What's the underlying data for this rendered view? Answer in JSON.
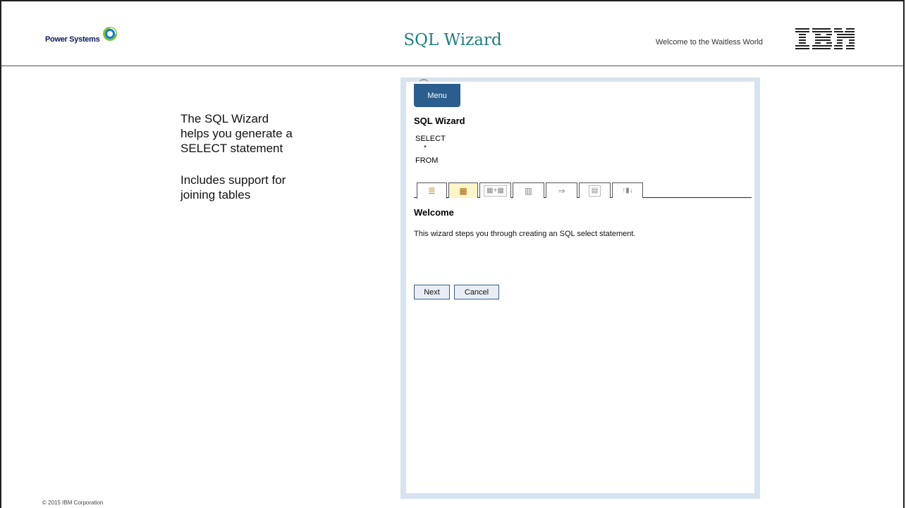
{
  "header": {
    "brand": "Power Systems",
    "title": "SQL Wizard",
    "tagline": "Welcome to the Waitless World",
    "company_logo": "IBM"
  },
  "bullets": [
    {
      "lines": [
        "The SQL Wizard",
        "helps you generate a",
        "SELECT statement"
      ]
    },
    {
      "lines": [
        "Includes support for",
        "joining tables"
      ]
    }
  ],
  "footer": {
    "copyright": "© 2015 IBM Corporation"
  },
  "wizard": {
    "menu_label": "Menu",
    "heading": "SQL Wizard",
    "sql_preview": [
      "SELECT",
      "*",
      "FROM"
    ],
    "tabs": [
      {
        "icon": "pencil-list-icon",
        "glyph": "≣",
        "active": true
      },
      {
        "icon": "table-icon",
        "glyph": "▦",
        "highlight": true
      },
      {
        "icon": "join-tables-icon",
        "glyph": "▦+▦"
      },
      {
        "icon": "column-icon",
        "glyph": "▥"
      },
      {
        "icon": "condition-icon",
        "glyph": "⇒"
      },
      {
        "icon": "summary-icon",
        "glyph": "▤"
      },
      {
        "icon": "sort-icon",
        "glyph": "↑▮↓"
      }
    ],
    "welcome_title": "Welcome",
    "welcome_text": "This wizard steps you through creating an SQL select statement.",
    "next_label": "Next",
    "cancel_label": "Cancel"
  },
  "colors": {
    "title": "#1e7f82",
    "menu_bg": "#2c5d8f",
    "frame": "#d7e3ef",
    "tab_highlight": "#fbf5c7"
  }
}
